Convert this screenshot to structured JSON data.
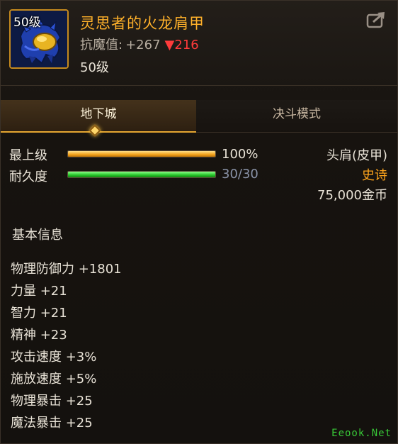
{
  "item": {
    "level_badge": "50级",
    "name": "灵思者的火龙肩甲",
    "resist_label": "抗魔值:",
    "resist_value": "+267",
    "resist_down": "▼216",
    "required_level": "50级"
  },
  "tabs": [
    {
      "label": "地下城",
      "active": true
    },
    {
      "label": "决斗模式",
      "active": false
    }
  ],
  "bars": {
    "quality_label": "最上级",
    "quality_value": "100%",
    "quality_fraction": 1.0,
    "durability_label": "耐久度",
    "durability_value": "30/30",
    "durability_fraction": 1.0
  },
  "info": {
    "slot": "头肩(皮甲)",
    "rarity": "史诗",
    "price": "75,000金币"
  },
  "basic": {
    "title": "基本信息",
    "stats": [
      "物理防御力 +1801",
      "力量 +21",
      "智力 +21",
      "精神 +23",
      "攻击速度 +3%",
      "施放速度 +5%",
      "物理暴击 +25",
      "魔法暴击 +25"
    ]
  },
  "watermark": "Eeook.Net",
  "colors": {
    "item_name": "#ffb12a",
    "rarity": "#ffa51c",
    "resist_down": "#ff3b3b",
    "quality_bar": "#f4a31c",
    "durability_bar": "#27c42a",
    "tab_accent": "#e5a631"
  },
  "icons": {
    "share": "share-icon",
    "item": "shoulder-armor-icon"
  }
}
